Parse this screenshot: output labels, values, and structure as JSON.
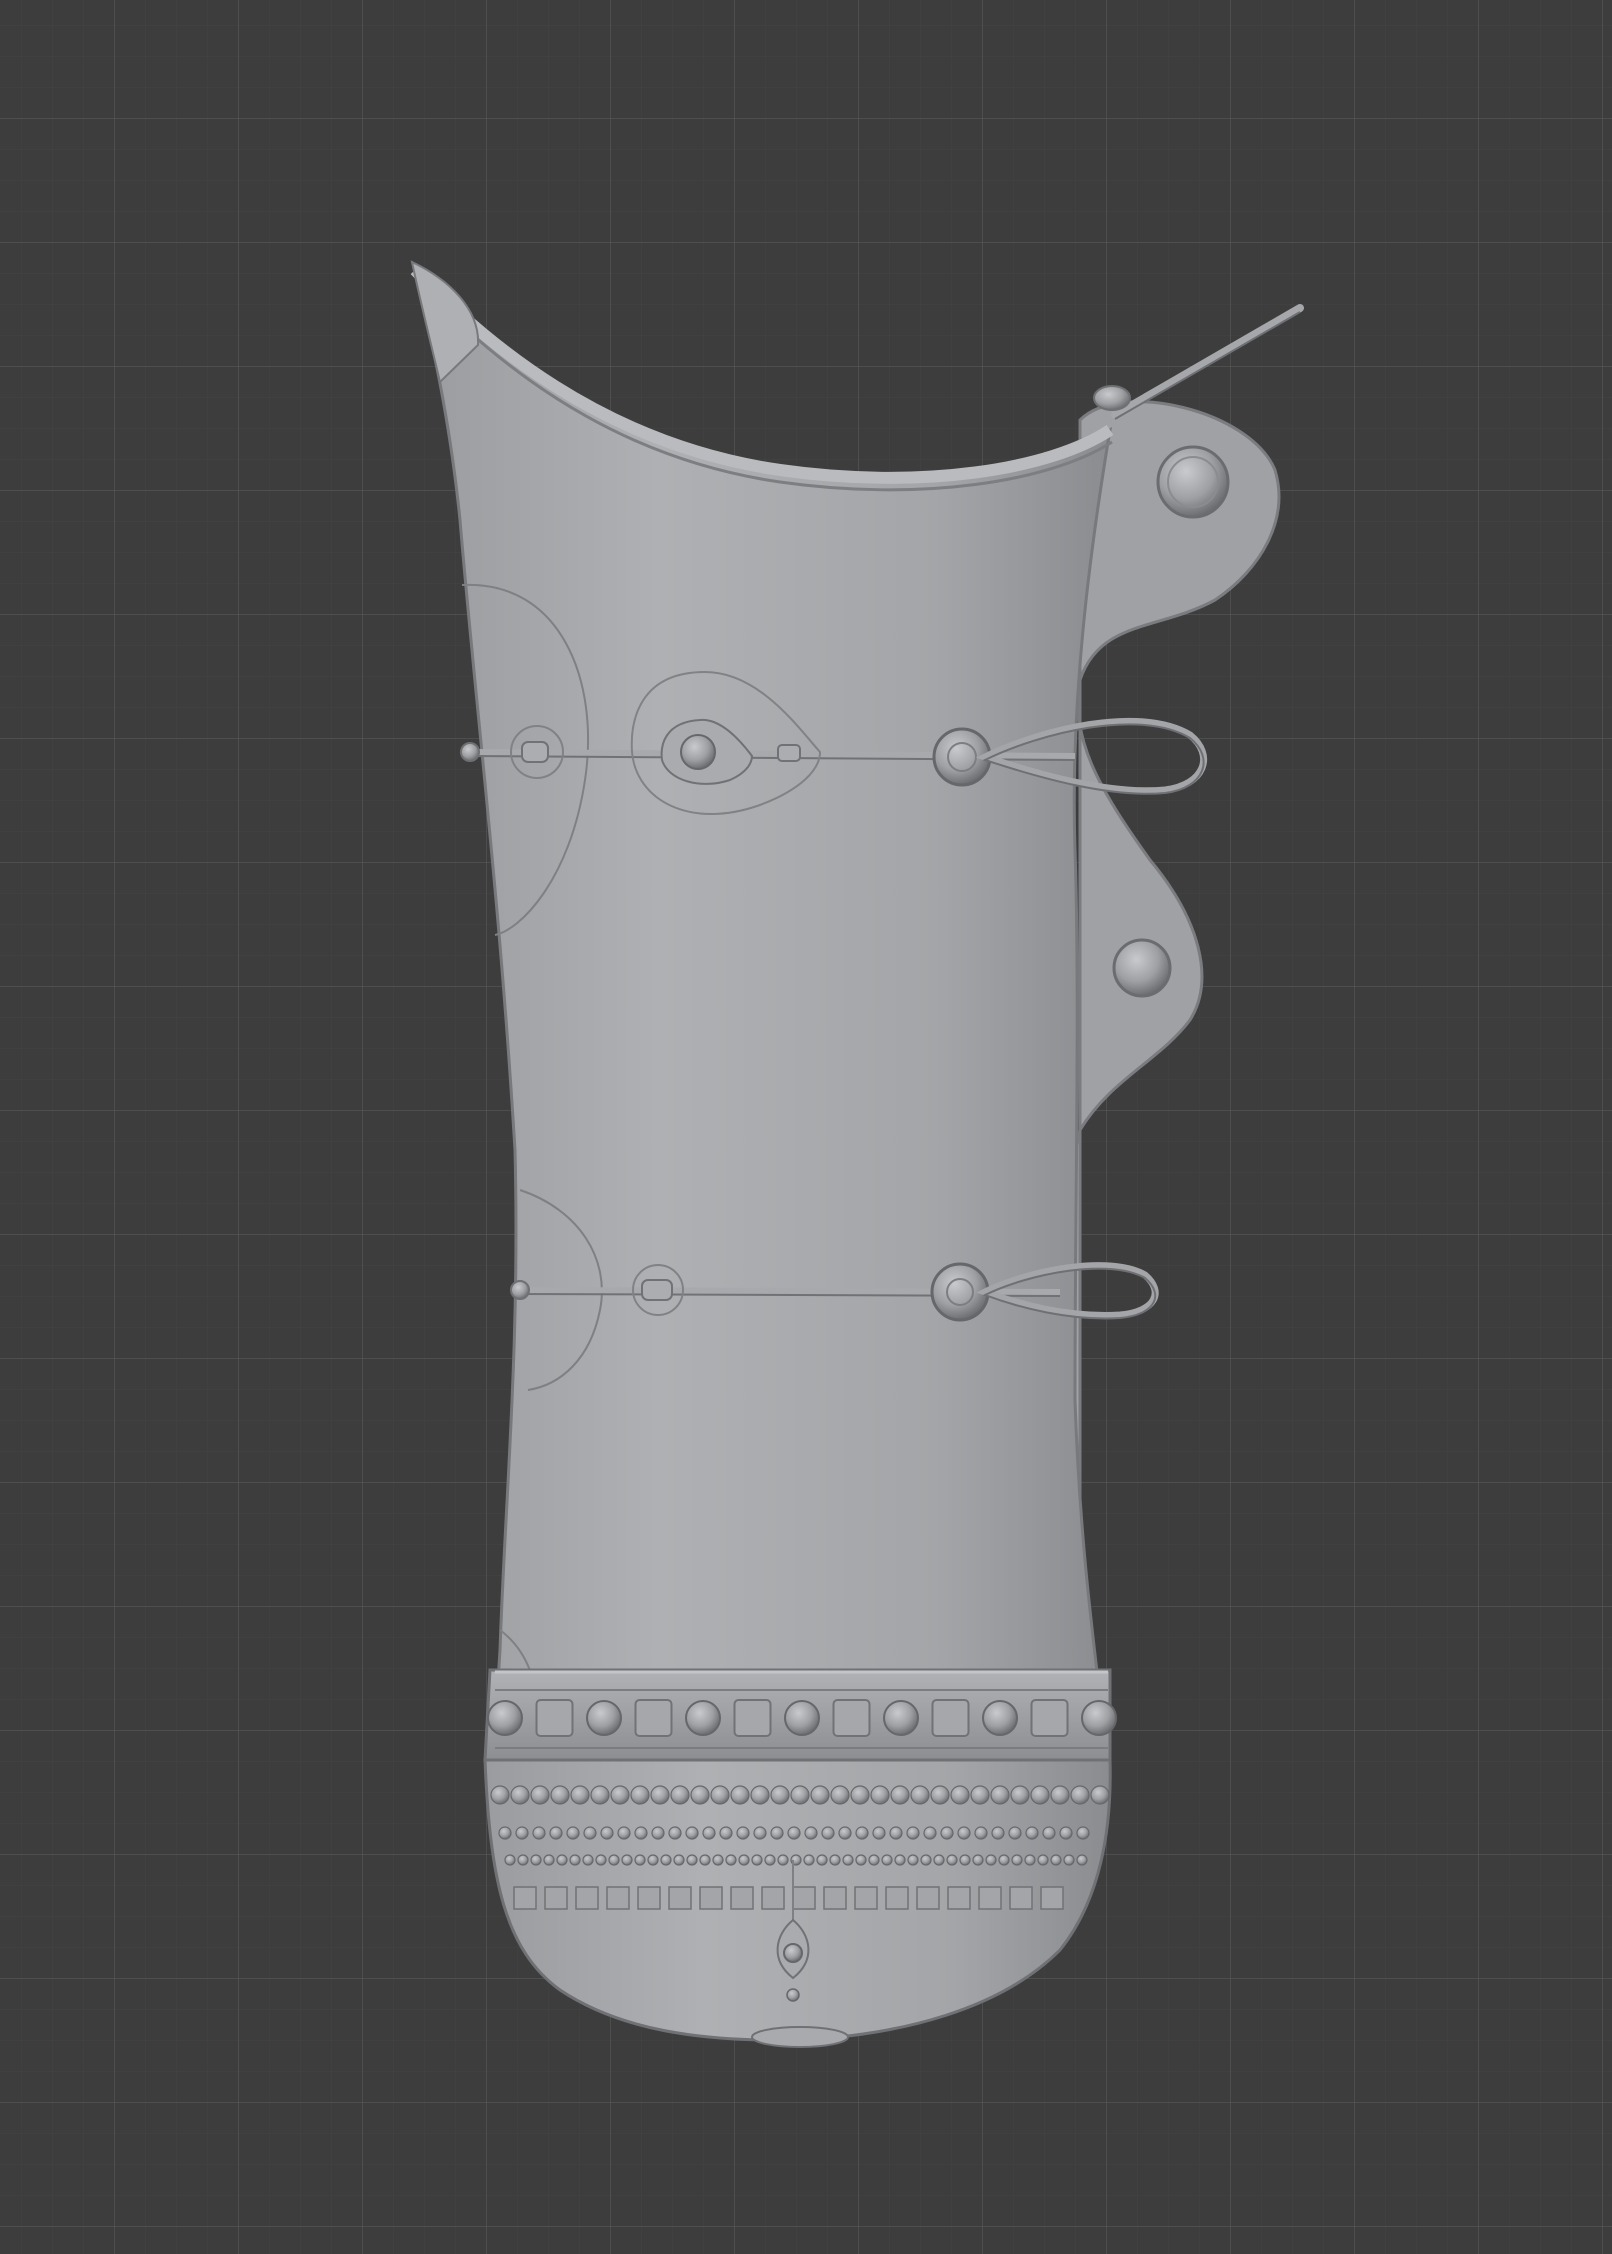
{
  "viewport": {
    "background_color": "#3d3d3d",
    "grid_major_color": "#5a5a5a",
    "grid_minor_color": "#464646"
  },
  "model": {
    "object": "vambrace-armor-piece",
    "surface_color": "#a3a5a8",
    "shadow_color": "#6f7174",
    "highlight_color": "#c3c5c8"
  }
}
